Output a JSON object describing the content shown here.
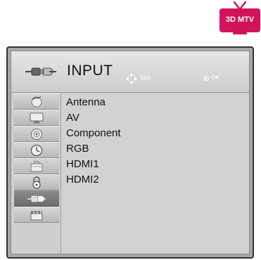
{
  "badge": {
    "text": "3D MTV",
    "color": "#d1145a"
  },
  "header": {
    "title": "INPUT",
    "icon": "input-cable-icon",
    "move_label": "Spo.",
    "ok_label": "OK"
  },
  "sidebar": {
    "items": [
      {
        "icon": "picture-satellite-icon",
        "active": false
      },
      {
        "icon": "screen-icon",
        "active": false
      },
      {
        "icon": "audio-disc-icon",
        "active": false
      },
      {
        "icon": "clock-icon",
        "active": false
      },
      {
        "icon": "option-briefcase-icon",
        "active": false
      },
      {
        "icon": "lock-icon",
        "active": false
      },
      {
        "icon": "input-cable-icon",
        "active": true
      },
      {
        "icon": "clapperboard-icon",
        "active": false
      }
    ]
  },
  "inputs": {
    "items": [
      {
        "label": "Antenna"
      },
      {
        "label": "AV"
      },
      {
        "label": "Component"
      },
      {
        "label": "RGB"
      },
      {
        "label": "HDMI1"
      },
      {
        "label": "HDMI2"
      }
    ]
  },
  "colors": {
    "frame_border": "#333333",
    "panel_background": "#cfcfcf",
    "active_sidebar": "#6d6d6d",
    "badge": "#d1145a"
  }
}
